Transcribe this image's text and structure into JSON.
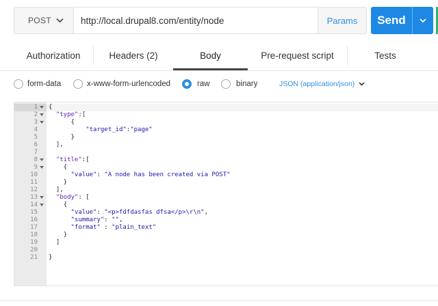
{
  "request": {
    "method": "POST",
    "url": "http://local.drupal8.com/entity/node",
    "params_label": "Params",
    "send_label": "Send"
  },
  "tabs": [
    {
      "label": "Authorization"
    },
    {
      "label": "Headers (2)"
    },
    {
      "label": "Body",
      "active": true
    },
    {
      "label": "Pre-request script"
    },
    {
      "label": "Tests"
    }
  ],
  "body_types": {
    "options": [
      "form-data",
      "x-www-form-urlencoded",
      "raw",
      "binary"
    ],
    "selected": "raw",
    "content_type": "JSON (application/json)"
  },
  "editor": {
    "lines": [
      {
        "n": "1",
        "fold": true,
        "parts": [
          [
            "pun",
            "{"
          ]
        ]
      },
      {
        "n": "2",
        "fold": true,
        "parts": [
          [
            "pun",
            "  "
          ],
          [
            "key",
            "\"type\""
          ],
          [
            "pun",
            ":["
          ]
        ]
      },
      {
        "n": "3",
        "fold": true,
        "parts": [
          [
            "pun",
            "      {"
          ]
        ]
      },
      {
        "n": "4",
        "fold": false,
        "parts": [
          [
            "pun",
            "          "
          ],
          [
            "str",
            "\"target_id\""
          ],
          [
            "pun",
            ":"
          ],
          [
            "str",
            "\"page\""
          ]
        ]
      },
      {
        "n": "5",
        "fold": false,
        "parts": [
          [
            "pun",
            "      }"
          ]
        ]
      },
      {
        "n": "6",
        "fold": false,
        "parts": [
          [
            "pun",
            "  ],"
          ]
        ]
      },
      {
        "n": "7",
        "fold": false,
        "parts": [
          [
            "pun",
            ""
          ]
        ]
      },
      {
        "n": "8",
        "fold": true,
        "parts": [
          [
            "pun",
            "  "
          ],
          [
            "key",
            "\"title\""
          ],
          [
            "pun",
            ":["
          ]
        ]
      },
      {
        "n": "9",
        "fold": true,
        "parts": [
          [
            "pun",
            "    {"
          ]
        ]
      },
      {
        "n": "10",
        "fold": false,
        "parts": [
          [
            "pun",
            "      "
          ],
          [
            "str",
            "\"value\""
          ],
          [
            "pun",
            ": "
          ],
          [
            "str",
            "\"A node has been created via POST\""
          ]
        ]
      },
      {
        "n": "11",
        "fold": false,
        "parts": [
          [
            "pun",
            "    }"
          ]
        ]
      },
      {
        "n": "12",
        "fold": false,
        "parts": [
          [
            "pun",
            "  ],"
          ]
        ]
      },
      {
        "n": "13",
        "fold": true,
        "parts": [
          [
            "pun",
            "  "
          ],
          [
            "key",
            "\"body\""
          ],
          [
            "pun",
            ": ["
          ]
        ]
      },
      {
        "n": "14",
        "fold": true,
        "parts": [
          [
            "pun",
            "    {"
          ]
        ]
      },
      {
        "n": "15",
        "fold": false,
        "parts": [
          [
            "pun",
            "      "
          ],
          [
            "str",
            "\"value\""
          ],
          [
            "pun",
            ": "
          ],
          [
            "str",
            "\"<p>fdfdasfas dfsa</p>\\r\\n\""
          ],
          [
            "pun",
            ","
          ]
        ]
      },
      {
        "n": "16",
        "fold": false,
        "parts": [
          [
            "pun",
            "      "
          ],
          [
            "str",
            "\"summary\""
          ],
          [
            "pun",
            ": "
          ],
          [
            "str",
            "\"\""
          ],
          [
            "pun",
            ","
          ]
        ]
      },
      {
        "n": "17",
        "fold": false,
        "parts": [
          [
            "pun",
            "      "
          ],
          [
            "str",
            "\"format\""
          ],
          [
            "pun",
            " : "
          ],
          [
            "str",
            "\"plain_text\""
          ]
        ]
      },
      {
        "n": "18",
        "fold": false,
        "parts": [
          [
            "pun",
            "    }"
          ]
        ]
      },
      {
        "n": "19",
        "fold": false,
        "parts": [
          [
            "pun",
            "  ]"
          ]
        ]
      },
      {
        "n": "20",
        "fold": false,
        "parts": [
          [
            "pun",
            ""
          ]
        ]
      },
      {
        "n": "21",
        "fold": false,
        "parts": [
          [
            "pun",
            "}"
          ]
        ]
      }
    ]
  },
  "colors": {
    "accent": "#2f8fe0",
    "send_button": "#1e88e5",
    "key_token": "#5a1fb0",
    "string_token": "#1a1aa6"
  }
}
